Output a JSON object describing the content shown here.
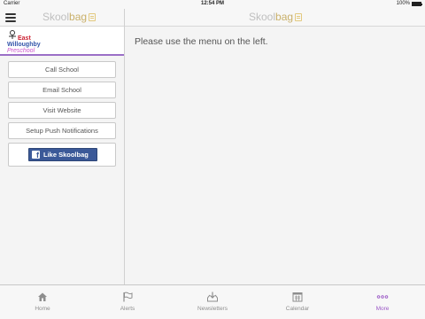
{
  "status_bar": {
    "carrier": "Carrier",
    "time": "12:54 PM",
    "battery": "100%",
    "battery_level": 1.0
  },
  "navbar": {
    "brand_part1": "Skool",
    "brand_part2": "bag"
  },
  "logo": {
    "line1": "East",
    "line2": "Willoughby",
    "line3": "Preschool"
  },
  "actions": [
    {
      "label": "Call School"
    },
    {
      "label": "Email School"
    },
    {
      "label": "Visit Website"
    },
    {
      "label": "Setup Push Notifications"
    }
  ],
  "like_button": {
    "label": "Like Skoolbag",
    "icon": "facebook-icon"
  },
  "main": {
    "message": "Please use the menu on the left."
  },
  "tabs": [
    {
      "label": "Home",
      "icon": "home-icon"
    },
    {
      "label": "Alerts",
      "icon": "flag-icon"
    },
    {
      "label": "Newsletters",
      "icon": "download-tray-icon"
    },
    {
      "label": "Calendar",
      "icon": "calendar-icon"
    },
    {
      "label": "More",
      "icon": "more-dots-icon",
      "active": true
    }
  ],
  "colors": {
    "accent": "#9b59c6",
    "facebook": "#3b5998",
    "logo_underline": "#9b6fc7"
  }
}
